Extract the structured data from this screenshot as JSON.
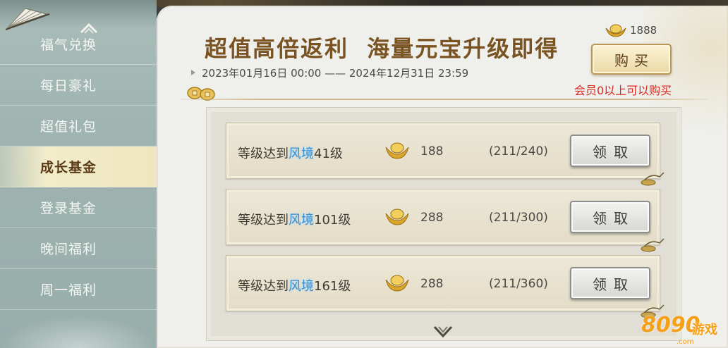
{
  "sidebar": {
    "items": [
      {
        "label": "福气兑换"
      },
      {
        "label": "每日豪礼"
      },
      {
        "label": "超值礼包"
      },
      {
        "label": "成长基金",
        "active": true
      },
      {
        "label": "登录基金"
      },
      {
        "label": "晚间福利"
      },
      {
        "label": "周一福利"
      }
    ]
  },
  "header": {
    "title": "超值高倍返利  海量元宝升级即得",
    "date_range": "2023年01月16日 00:00 —— 2024年12月31日 23:59",
    "price": "1888",
    "buy_label": "购买",
    "member_note": "会员0以上可以购买"
  },
  "rewards": [
    {
      "prefix": "等级达到",
      "realm": "风境",
      "level": "41级",
      "amount": "188",
      "progress": "(211/240)",
      "claim_label": "领取"
    },
    {
      "prefix": "等级达到",
      "realm": "风境",
      "level": "101级",
      "amount": "288",
      "progress": "(211/300)",
      "claim_label": "领取"
    },
    {
      "prefix": "等级达到",
      "realm": "风境",
      "level": "161级",
      "amount": "288",
      "progress": "(211/360)",
      "claim_label": "领取"
    }
  ],
  "watermark": {
    "number": "8090",
    "text": "游戏",
    "domain": ".com"
  },
  "colors": {
    "title": "#7a5322",
    "member_note": "#d62b22",
    "realm": "#3a8fd0",
    "sidebar_active_bg": "#efe6bf",
    "watermark": "#f5a019"
  }
}
